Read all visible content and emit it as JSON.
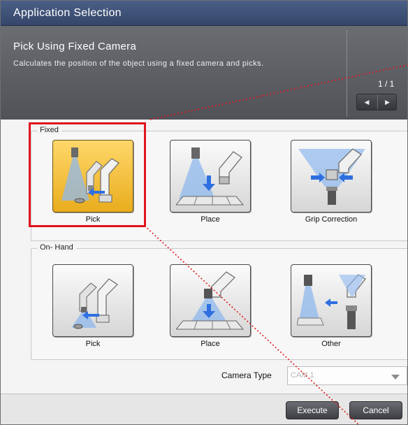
{
  "window": {
    "title": "Application Selection"
  },
  "header": {
    "title": "Pick Using Fixed Camera",
    "description": "Calculates the position of the object using a fixed camera and picks.",
    "page_indicator": "1 / 1",
    "prev_icon": "triangle-left-icon",
    "next_icon": "triangle-right-icon"
  },
  "groups": {
    "fixed": {
      "label": "Fixed",
      "items": [
        {
          "label": "Pick",
          "icon": "fixed-pick-icon",
          "selected": true
        },
        {
          "label": "Place",
          "icon": "fixed-place-icon",
          "selected": false
        },
        {
          "label": "Grip Correction",
          "icon": "grip-correction-icon",
          "selected": false
        }
      ]
    },
    "onhand": {
      "label": "On- Hand",
      "items": [
        {
          "label": "Pick",
          "icon": "onhand-pick-icon",
          "selected": false
        },
        {
          "label": "Place",
          "icon": "onhand-place-icon",
          "selected": false
        },
        {
          "label": "Other",
          "icon": "onhand-other-icon",
          "selected": false
        }
      ]
    }
  },
  "camera_type": {
    "label": "Camera Type",
    "value": "CAM 1",
    "icon": "chevron-down-icon"
  },
  "footer": {
    "execute_label": "Execute",
    "cancel_label": "Cancel"
  },
  "colors": {
    "titlebar": "#3f527a",
    "header": "#5e6065",
    "selected_tile": "#f2be3a",
    "highlight_box": "#e1141e",
    "light_beam": "#8fb8ee",
    "arrow_blue": "#2f6fe0"
  }
}
